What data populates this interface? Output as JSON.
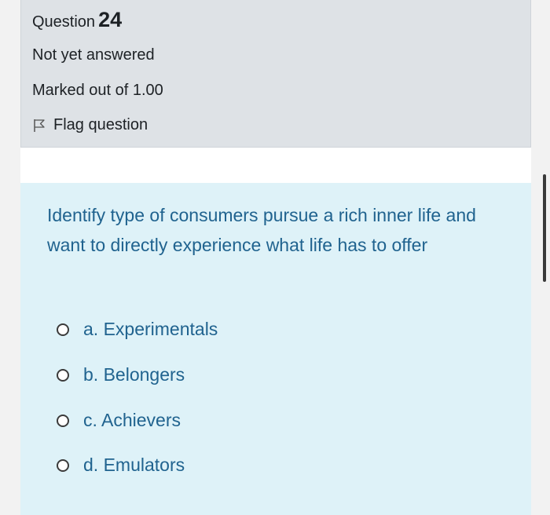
{
  "question": {
    "label": "Question",
    "number": "24",
    "state": "Not yet answered",
    "grade": "Marked out of 1.00",
    "flag_label": "Flag question",
    "flag_icon": "flag-icon"
  },
  "question_text": "Identify type of consumers pursue a rich inner life and want to directly experience what life has to offer",
  "options": [
    {
      "label": "a. Experimentals"
    },
    {
      "label": "b. Belongers"
    },
    {
      "label": "c. Achievers"
    },
    {
      "label": "d. Emulators"
    }
  ],
  "colors": {
    "info_bg": "#dee2e6",
    "qtext_bg": "#def2f8",
    "qtext_color": "#20638f"
  }
}
